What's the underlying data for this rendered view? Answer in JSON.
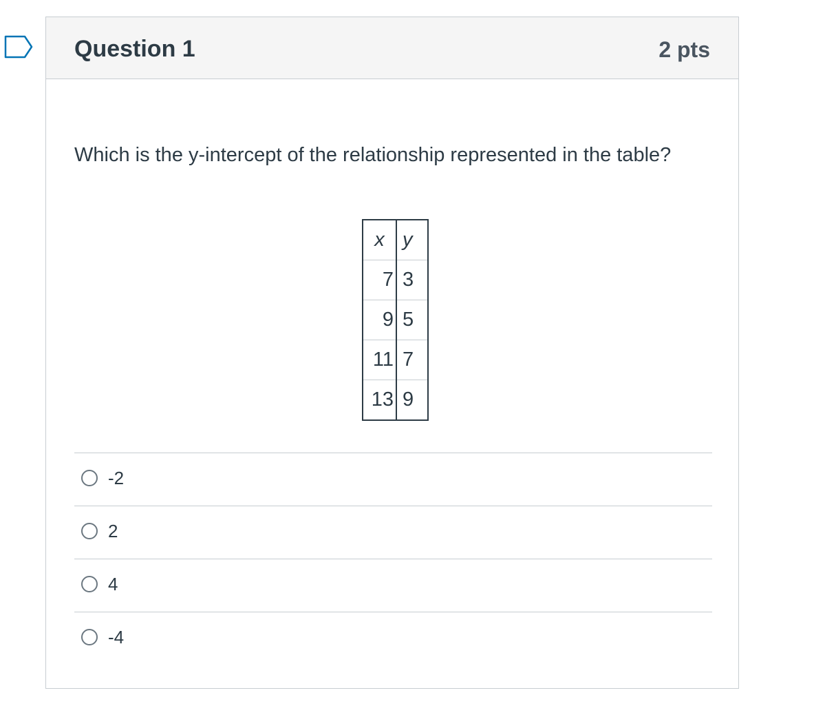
{
  "question": {
    "title": "Question 1",
    "points": "2 pts",
    "text": "Which is the y-intercept of the relationship represented in the table?",
    "flag_icon": "flag-question-icon"
  },
  "table": {
    "headers": [
      "x",
      "y"
    ],
    "rows": [
      [
        "7",
        "3"
      ],
      [
        "9",
        "5"
      ],
      [
        "11",
        "7"
      ],
      [
        "13",
        "9"
      ]
    ]
  },
  "answers": [
    {
      "label": "-2",
      "selected": false
    },
    {
      "label": "2",
      "selected": false
    },
    {
      "label": "4",
      "selected": false
    },
    {
      "label": "-4",
      "selected": false
    }
  ]
}
